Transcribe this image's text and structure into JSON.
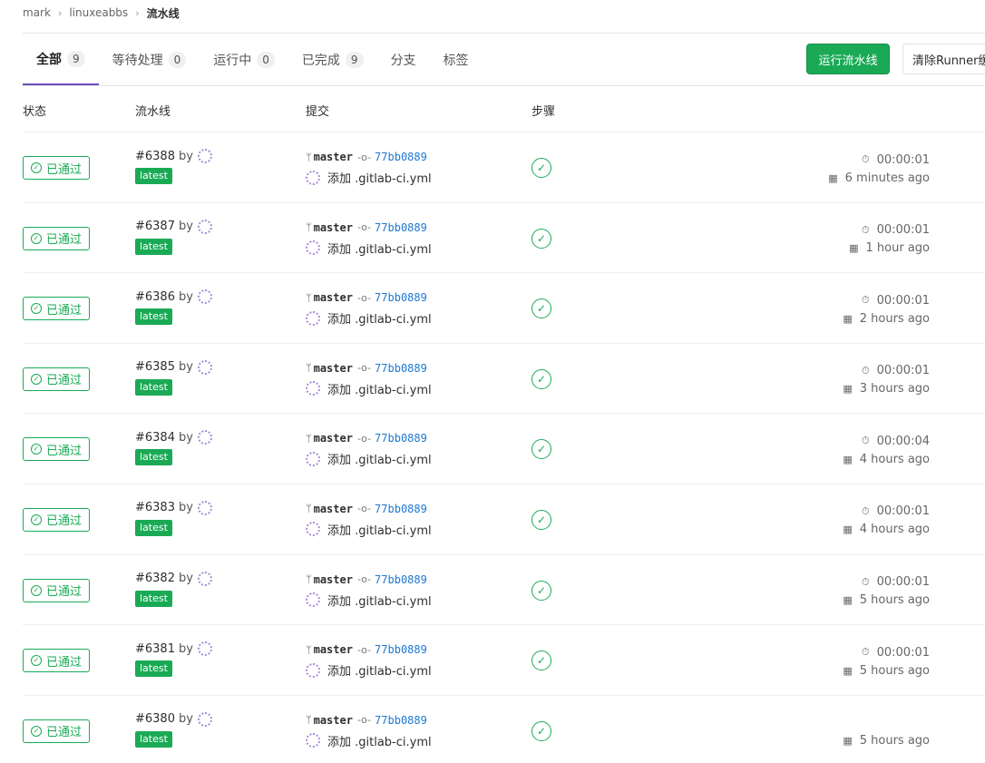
{
  "breadcrumb": {
    "items": [
      "mark",
      "linuxeabbs"
    ],
    "current": "流水线"
  },
  "tabs": [
    {
      "label": "全部",
      "count": "9"
    },
    {
      "label": "等待处理",
      "count": "0"
    },
    {
      "label": "运行中",
      "count": "0"
    },
    {
      "label": "已完成",
      "count": "9"
    },
    {
      "label": "分支"
    },
    {
      "label": "标签"
    }
  ],
  "buttons": {
    "run": "运行流水线",
    "clear": "清除Runner缓存"
  },
  "table": {
    "headers": [
      "状态",
      "流水线",
      "提交",
      "步骤"
    ]
  },
  "colors": {
    "success": "#1aaa55",
    "link": "#1f78d1",
    "active_tab": "#6b4fbb"
  },
  "pipelines": [
    {
      "status": "已通过",
      "id": "#6388",
      "by": "by",
      "badge": "latest",
      "branch": "master",
      "sha": "77bb0889",
      "message": "添加 .gitlab-ci.yml",
      "duration": "00:00:01",
      "ago": "6 minutes ago"
    },
    {
      "status": "已通过",
      "id": "#6387",
      "by": "by",
      "badge": "latest",
      "branch": "master",
      "sha": "77bb0889",
      "message": "添加 .gitlab-ci.yml",
      "duration": "00:00:01",
      "ago": "1 hour ago"
    },
    {
      "status": "已通过",
      "id": "#6386",
      "by": "by",
      "badge": "latest",
      "branch": "master",
      "sha": "77bb0889",
      "message": "添加 .gitlab-ci.yml",
      "duration": "00:00:01",
      "ago": "2 hours ago"
    },
    {
      "status": "已通过",
      "id": "#6385",
      "by": "by",
      "badge": "latest",
      "branch": "master",
      "sha": "77bb0889",
      "message": "添加 .gitlab-ci.yml",
      "duration": "00:00:01",
      "ago": "3 hours ago"
    },
    {
      "status": "已通过",
      "id": "#6384",
      "by": "by",
      "badge": "latest",
      "branch": "master",
      "sha": "77bb0889",
      "message": "添加 .gitlab-ci.yml",
      "duration": "00:00:04",
      "ago": "4 hours ago"
    },
    {
      "status": "已通过",
      "id": "#6383",
      "by": "by",
      "badge": "latest",
      "branch": "master",
      "sha": "77bb0889",
      "message": "添加 .gitlab-ci.yml",
      "duration": "00:00:01",
      "ago": "4 hours ago"
    },
    {
      "status": "已通过",
      "id": "#6382",
      "by": "by",
      "badge": "latest",
      "branch": "master",
      "sha": "77bb0889",
      "message": "添加 .gitlab-ci.yml",
      "duration": "00:00:01",
      "ago": "5 hours ago"
    },
    {
      "status": "已通过",
      "id": "#6381",
      "by": "by",
      "badge": "latest",
      "branch": "master",
      "sha": "77bb0889",
      "message": "添加 .gitlab-ci.yml",
      "duration": "00:00:01",
      "ago": "5 hours ago"
    },
    {
      "status": "已通过",
      "id": "#6380",
      "by": "by",
      "badge": "latest",
      "branch": "master",
      "sha": "77bb0889",
      "message": "添加 .gitlab-ci.yml",
      "ago": "5 hours ago"
    }
  ]
}
